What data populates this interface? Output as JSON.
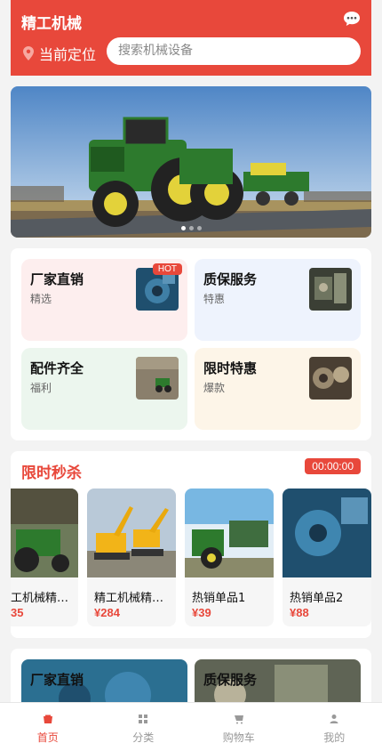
{
  "header": {
    "title": "精工机械",
    "location_label": "当前定位",
    "search_placeholder": "搜索机械设备",
    "colors": {
      "brand": "#e8483b"
    },
    "icons": [
      "message-icon",
      "location-pin-icon"
    ]
  },
  "banner": {
    "slides": 3,
    "active_slide": 1
  },
  "services": [
    {
      "title": "厂家直销",
      "subtitle": "精选",
      "badge": "HOT",
      "bg": "#fdeeee"
    },
    {
      "title": "质保服务",
      "subtitle": "特惠",
      "bg": "#eef3fd"
    },
    {
      "title": "配件齐全",
      "subtitle": "福利",
      "bg": "#ecf6ee"
    },
    {
      "title": "限时特惠",
      "subtitle": "爆款",
      "bg": "#fdf5e8"
    }
  ],
  "flash_sale": {
    "title": "限时秒杀",
    "timer": "00:00:00",
    "products": [
      {
        "name": "工机械精…",
        "price": "35"
      },
      {
        "name": "精工机械精…",
        "price": "¥284"
      },
      {
        "name": "热销单品1",
        "price": "¥39"
      },
      {
        "name": "热销单品2",
        "price": "¥88"
      }
    ]
  },
  "bottom_section": {
    "items": [
      "厂家直销",
      "质保服务"
    ]
  },
  "tabbar": {
    "tabs": [
      {
        "label": "首页",
        "icon": "home-icon",
        "active": true
      },
      {
        "label": "分类",
        "icon": "grid-icon"
      },
      {
        "label": "购物车",
        "icon": "cart-icon"
      },
      {
        "label": "我的",
        "icon": "user-icon"
      }
    ]
  }
}
